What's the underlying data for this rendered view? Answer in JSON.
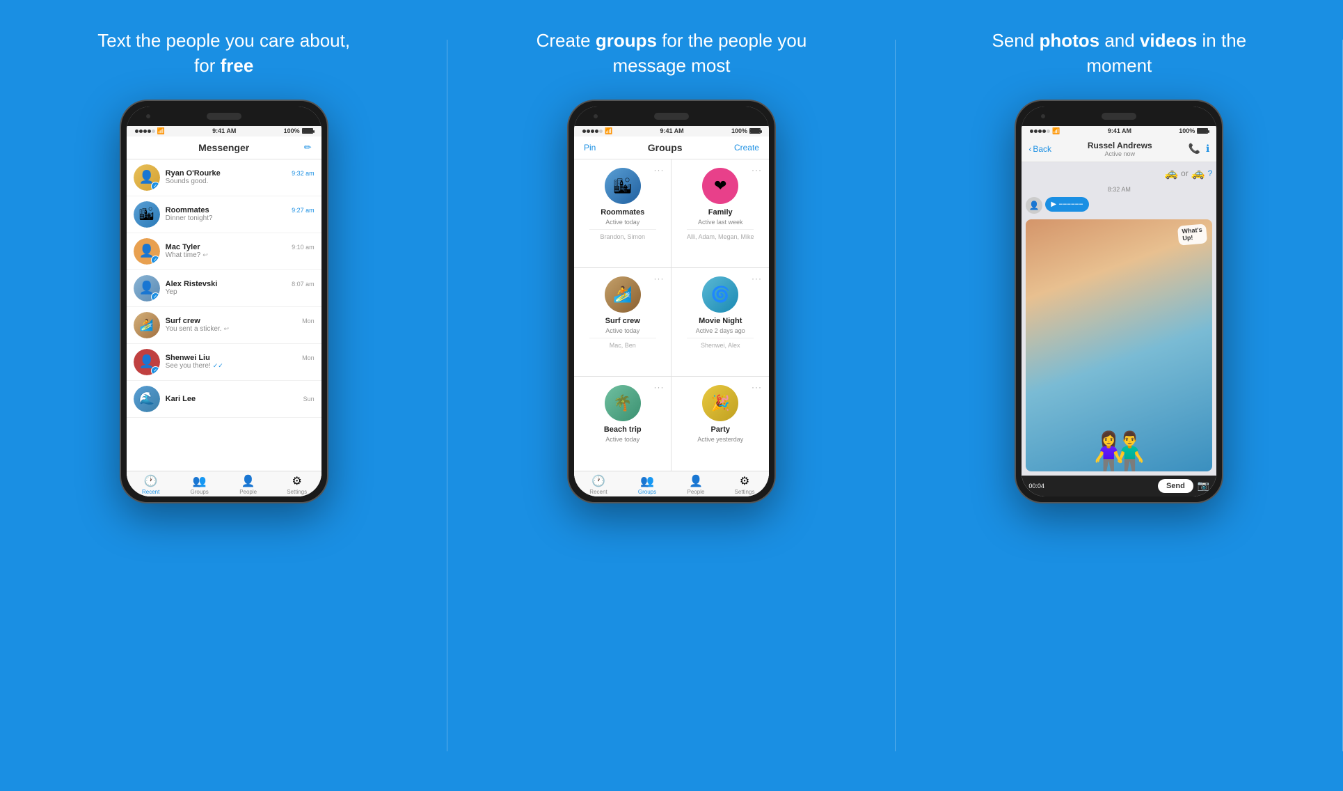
{
  "panels": [
    {
      "id": "panel1",
      "headline_normal": "Text the people you care about, for ",
      "headline_bold": "free",
      "phone": {
        "status_time": "9:41 AM",
        "status_battery": "100%",
        "header_title": "Messenger",
        "compose_label": "✏",
        "chats": [
          {
            "name": "Ryan O'Rourke",
            "preview": "Sounds good.",
            "time": "9:32 am",
            "time_blue": true,
            "badge": true,
            "avatar": "ryan"
          },
          {
            "name": "Roommates",
            "preview": "Dinner tonight?",
            "time": "9:27 am",
            "time_blue": true,
            "badge": false,
            "avatar": "roommates"
          },
          {
            "name": "Mac Tyler",
            "preview": "What time?",
            "time": "9:10 am",
            "time_blue": false,
            "badge": true,
            "avatar": "mac",
            "sent": true
          },
          {
            "name": "Alex Ristevski",
            "preview": "Yep",
            "time": "8:07 am",
            "time_blue": false,
            "badge": true,
            "avatar": "alex"
          },
          {
            "name": "Surf crew",
            "preview": "You sent a sticker.",
            "time": "Mon",
            "time_blue": false,
            "badge": false,
            "avatar": "surf",
            "sent": true
          },
          {
            "name": "Shenwei Liu",
            "preview": "See you there!",
            "time": "Mon",
            "time_blue": false,
            "badge": true,
            "avatar": "shen",
            "check": true
          },
          {
            "name": "Kari Lee",
            "preview": "",
            "time": "Sun",
            "time_blue": false,
            "badge": false,
            "avatar": "kari"
          }
        ],
        "tabs": [
          {
            "icon": "🕐",
            "label": "Recent",
            "active": true
          },
          {
            "icon": "👥",
            "label": "Groups",
            "active": false
          },
          {
            "icon": "👤",
            "label": "People",
            "active": false
          },
          {
            "icon": "⚙",
            "label": "Settings",
            "active": false
          }
        ]
      }
    },
    {
      "id": "panel2",
      "headline_parts": [
        "Create ",
        "groups",
        " for the people you message most"
      ],
      "phone": {
        "status_time": "9:41 AM",
        "pin_label": "Pin",
        "header_title": "Groups",
        "create_label": "Create",
        "groups": [
          {
            "name": "Roommates",
            "status": "Active today",
            "members": "Brandon, Simon",
            "avatar": "roommates"
          },
          {
            "name": "Family",
            "status": "Active last week",
            "members": "Alli, Adam, Megan, Mike",
            "avatar": "family"
          },
          {
            "name": "Surf crew",
            "status": "Active today",
            "members": "Mac, Ben",
            "avatar": "surf"
          },
          {
            "name": "Movie Night",
            "status": "Active 2 days ago",
            "members": "Shenwei, Alex",
            "avatar": "movie"
          },
          {
            "name": "Beach trip",
            "status": "Active today",
            "members": "",
            "avatar": "beach"
          },
          {
            "name": "Party",
            "status": "Active yesterday",
            "members": "",
            "avatar": "other"
          }
        ],
        "tabs": [
          {
            "icon": "🕐",
            "label": "Recent",
            "active": false
          },
          {
            "icon": "👥",
            "label": "Groups",
            "active": true
          },
          {
            "icon": "👤",
            "label": "People",
            "active": false
          },
          {
            "icon": "⚙",
            "label": "Settings",
            "active": false
          }
        ]
      }
    },
    {
      "id": "panel3",
      "headline_parts": [
        "Send ",
        "photos",
        " and ",
        "videos",
        " in the moment"
      ],
      "phone": {
        "status_time": "9:41 AM",
        "back_label": "Back",
        "contact_name": "Russel Andrews",
        "contact_status": "Active now",
        "msg_time": "8:32 AM",
        "video_timer": "00:04",
        "send_label": "Send"
      }
    }
  ]
}
